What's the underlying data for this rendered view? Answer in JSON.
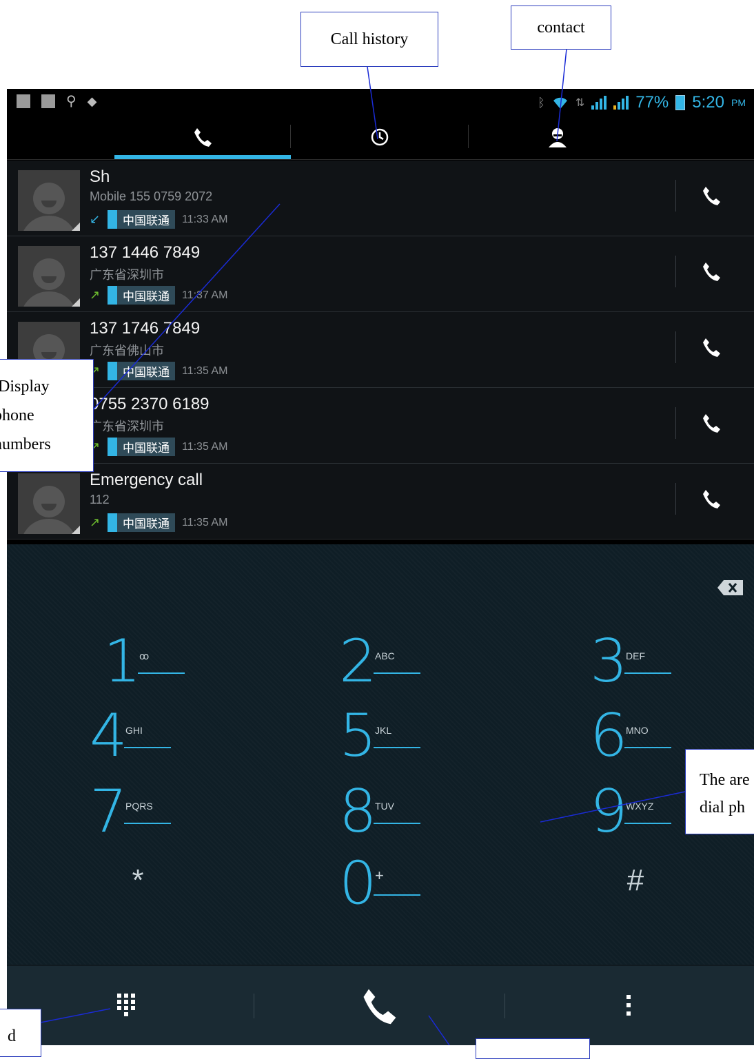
{
  "status_bar": {
    "icons_left": [
      "notification-icon",
      "gallery-icon",
      "usb-icon",
      "android-debug-icon"
    ],
    "battery": "77%",
    "time": "5:20",
    "ampm": "PM"
  },
  "tabs": [
    {
      "name": "dialpad",
      "icon": "phone-icon",
      "selected": true
    },
    {
      "name": "call-log",
      "icon": "clock-icon",
      "selected": false
    },
    {
      "name": "contacts",
      "icon": "person-icon",
      "selected": false
    }
  ],
  "calls": [
    {
      "name": "Sh",
      "detail": "Mobile 155 0759 2072",
      "type": "incoming",
      "carrier": "中国联通",
      "time": "11:33 AM"
    },
    {
      "name": "137 1446 7849",
      "detail": "广东省深圳市",
      "type": "outgoing",
      "carrier": "中国联通",
      "time": "11:37 AM"
    },
    {
      "name": "137 1746 7849",
      "detail": "广东省佛山市",
      "type": "outgoing",
      "carrier": "中国联通",
      "time": "11:35 AM"
    },
    {
      "name": "0755 2370 6189",
      "detail": "广东省深圳市",
      "type": "outgoing",
      "carrier": "中国联通",
      "time": "11:35 AM"
    },
    {
      "name": "Emergency call",
      "detail": "112",
      "type": "outgoing",
      "carrier": "中国联通",
      "time": "11:35 AM"
    }
  ],
  "dialpad": {
    "keys": [
      {
        "digit": "1",
        "letters": "ꝏ"
      },
      {
        "digit": "2",
        "letters": "ABC"
      },
      {
        "digit": "3",
        "letters": "DEF"
      },
      {
        "digit": "4",
        "letters": "GHI"
      },
      {
        "digit": "5",
        "letters": "JKL"
      },
      {
        "digit": "6",
        "letters": "MNO"
      },
      {
        "digit": "7",
        "letters": "PQRS"
      },
      {
        "digit": "8",
        "letters": "TUV"
      },
      {
        "digit": "9",
        "letters": "WXYZ"
      },
      {
        "digit": "0",
        "letters": "+"
      }
    ],
    "star": "*",
    "hash": "#"
  },
  "bottom_bar": {
    "left_icon": "dialpad-grid-icon",
    "center_icon": "call-icon",
    "right_icon": "overflow-menu-icon"
  },
  "annotations": {
    "call_history": "Call history",
    "contact": "contact",
    "display_line1": "Display",
    "display_line2": "phone",
    "display_line3": "numbers",
    "dial_area_line1": "The are",
    "dial_area_line2": "dial ph",
    "dialpad_label": "d"
  },
  "colors": {
    "accent": "#33b5e5",
    "background": "#000000",
    "dialer_bg": "#0f1e26",
    "callout_border": "#2b3dbd"
  }
}
